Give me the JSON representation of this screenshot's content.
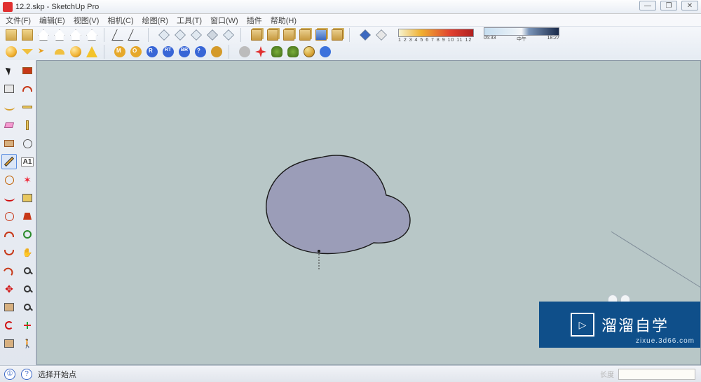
{
  "title_bar": {
    "filename": "12.2.skp",
    "app_name": "SketchUp Pro"
  },
  "window_controls": {
    "min": "—",
    "max": "❐",
    "close": "✕"
  },
  "menu": {
    "file": "文件(F)",
    "edit": "编辑(E)",
    "view": "视图(V)",
    "camera": "相机(C)",
    "draw": "绘图(R)",
    "tools": "工具(T)",
    "window": "窗口(W)",
    "plugins": "插件",
    "help": "帮助(H)"
  },
  "gradient_ticks": "1  2  3  4  5  6  7  8  9  10 11 12",
  "time_widget": {
    "left": "05:33",
    "mid": "中午",
    "right": "18:27"
  },
  "status": {
    "icon1": "①",
    "icon2": "?",
    "hint": "选择开始点",
    "dim_label": "长度"
  },
  "watermark": {
    "brand": "溜溜自学",
    "url": "zixue.3d66.com",
    "logo": "▷"
  },
  "ruler_label": "A1"
}
